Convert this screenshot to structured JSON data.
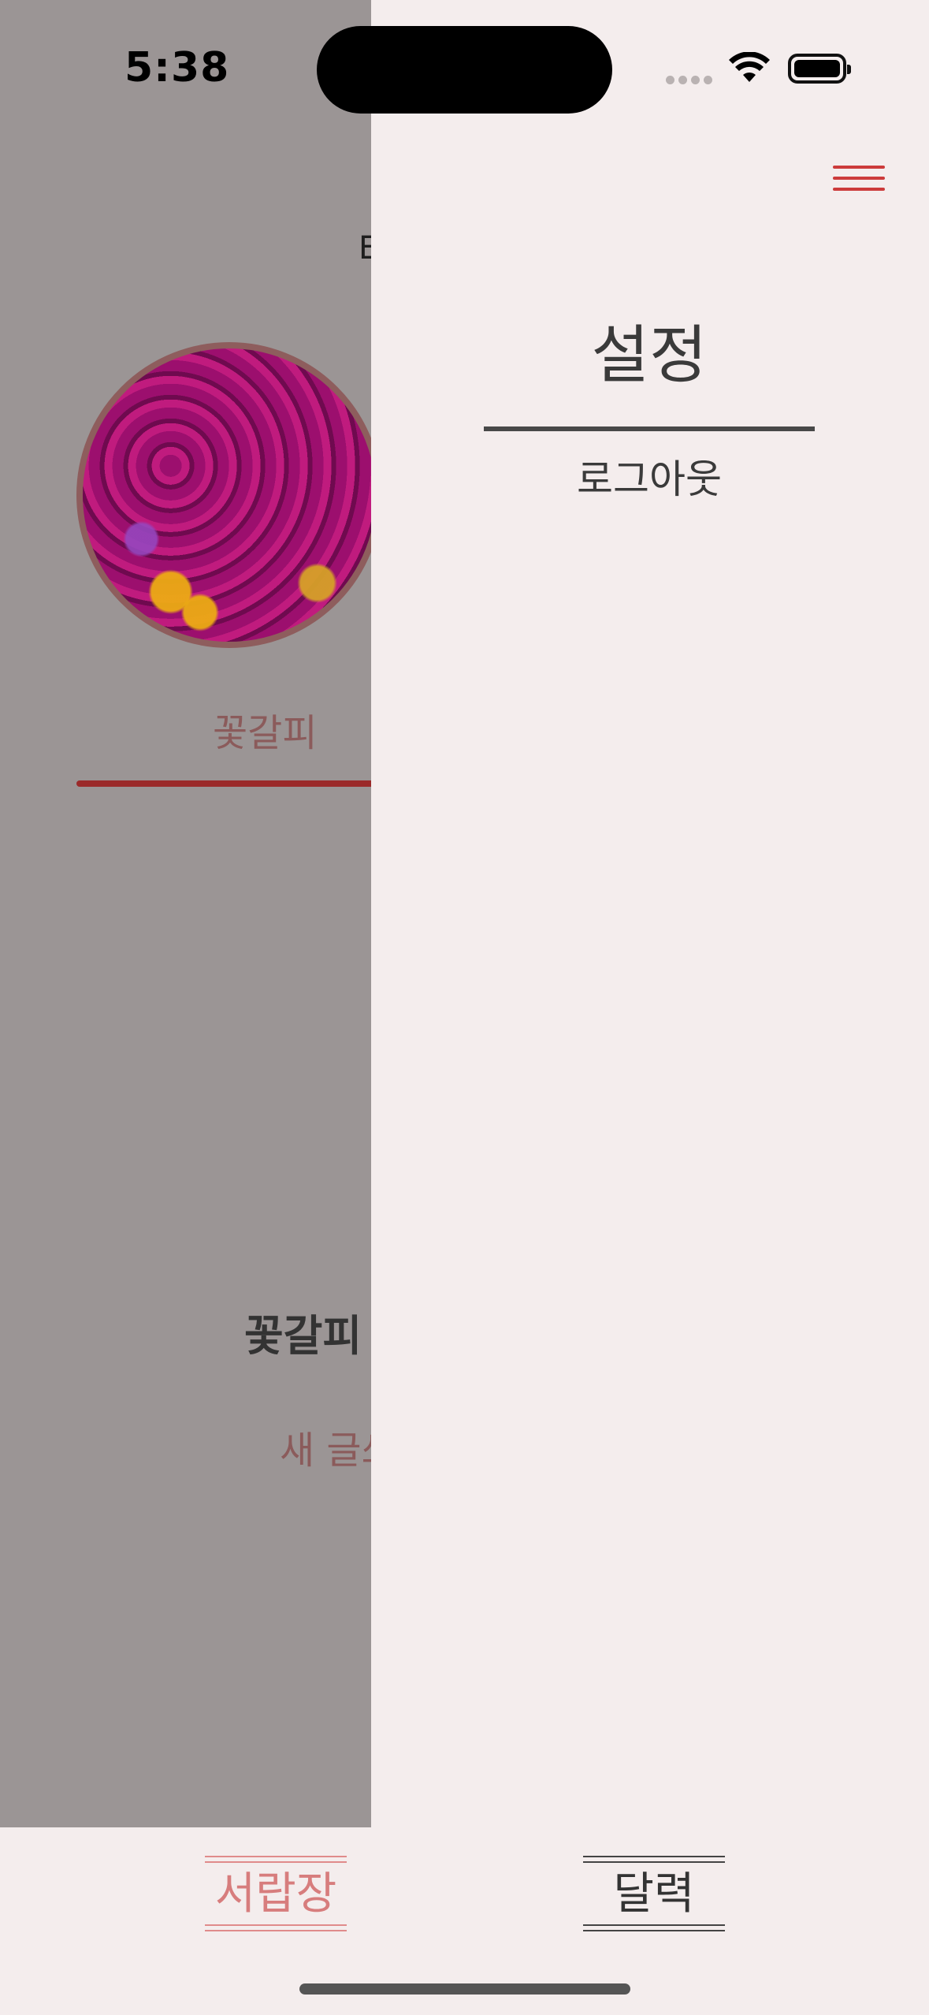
{
  "status_bar": {
    "time": "5:38"
  },
  "background_screen": {
    "header_partial": "E",
    "profile_name": "꽃갈피",
    "feed_title": "꽃갈피",
    "new_post_partial": "새 글쓰"
  },
  "drawer": {
    "title": "설정",
    "logout_label": "로그아웃"
  },
  "tab_bar": {
    "items": [
      {
        "label": "서랍장",
        "active": true
      },
      {
        "label": "달력",
        "active": false
      }
    ]
  },
  "colors": {
    "accent_red": "#cc3b3b",
    "active_tab": "#d77d7d",
    "drawer_bg": "#f4eded",
    "overlay": "#9b9595"
  }
}
